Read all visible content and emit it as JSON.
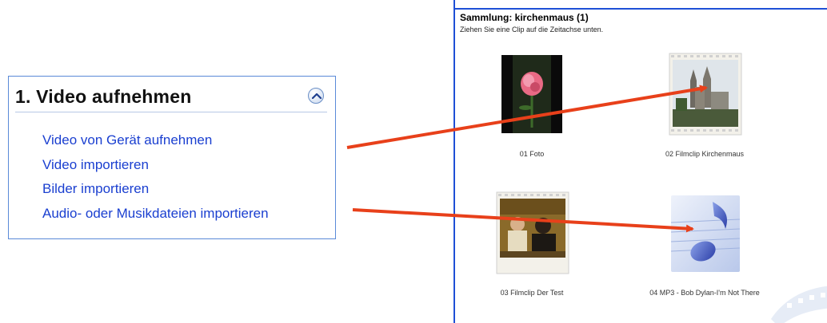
{
  "task_panel": {
    "title": "1. Video aufnehmen",
    "links": [
      "Video von Gerät aufnehmen",
      "Video importieren",
      "Bilder importieren",
      "Audio- oder Musikdateien importieren"
    ],
    "collapse_icon": "chevron-up-circle"
  },
  "collection": {
    "title": "Sammlung: kirchenmaus (1)",
    "subtitle": "Ziehen Sie eine Clip auf die Zeitachse unten.",
    "clips": [
      {
        "caption": "01 Foto",
        "kind": "photo"
      },
      {
        "caption": "02 Filmclip Kirchenmaus",
        "kind": "video"
      },
      {
        "caption": "03 Filmclip Der Test",
        "kind": "video"
      },
      {
        "caption": "04 MP3 - Bob Dylan-I'm Not There",
        "kind": "audio"
      }
    ]
  },
  "colors": {
    "link": "#1a3fd0",
    "panel_border": "#5a8ad8",
    "collection_border": "#1e4fd6",
    "arrow": "#e8401a"
  }
}
